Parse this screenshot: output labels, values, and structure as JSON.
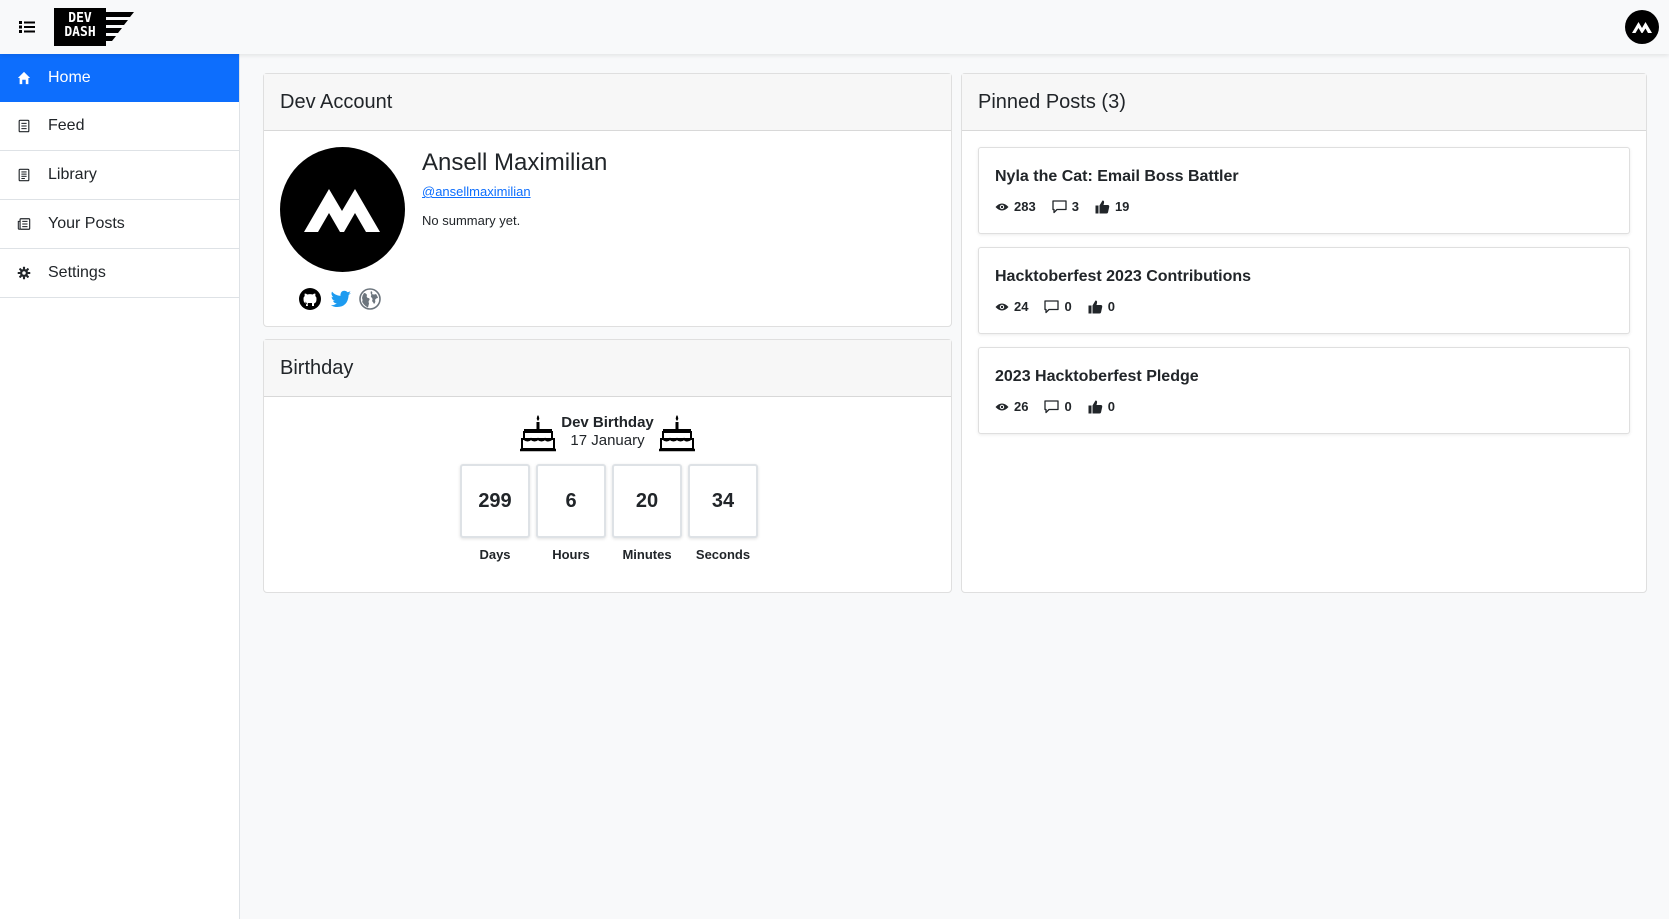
{
  "app": {
    "logo_line1": "DEV",
    "logo_line2": "DASH"
  },
  "sidebar": {
    "items": [
      {
        "label": "Home",
        "icon": "home-icon",
        "active": true
      },
      {
        "label": "Feed",
        "icon": "feed-icon",
        "active": false
      },
      {
        "label": "Library",
        "icon": "library-icon",
        "active": false
      },
      {
        "label": "Your Posts",
        "icon": "posts-icon",
        "active": false
      },
      {
        "label": "Settings",
        "icon": "gear-icon",
        "active": false
      }
    ]
  },
  "dev_account": {
    "header": "Dev Account",
    "name": "Ansell Maximilian",
    "handle": "@ansellmaximilian",
    "summary": "No summary yet.",
    "socials": [
      "github-icon",
      "twitter-icon",
      "globe-icon"
    ]
  },
  "birthday": {
    "header": "Birthday",
    "label": "Dev Birthday",
    "date": "17 January",
    "countdown": [
      {
        "value": "299",
        "unit": "Days"
      },
      {
        "value": "6",
        "unit": "Hours"
      },
      {
        "value": "20",
        "unit": "Minutes"
      },
      {
        "value": "34",
        "unit": "Seconds"
      }
    ]
  },
  "pinned": {
    "header": "Pinned Posts (3)",
    "posts": [
      {
        "title": "Nyla the Cat: Email Boss Battler",
        "views": "283",
        "comments": "3",
        "likes": "19"
      },
      {
        "title": "Hacktoberfest 2023 Contributions",
        "views": "24",
        "comments": "0",
        "likes": "0"
      },
      {
        "title": "2023 Hacktoberfest Pledge",
        "views": "26",
        "comments": "0",
        "likes": "0"
      }
    ]
  },
  "colors": {
    "accent": "#0d6efd",
    "twitter": "#1d9bf0",
    "background": "#f8f9fa"
  }
}
